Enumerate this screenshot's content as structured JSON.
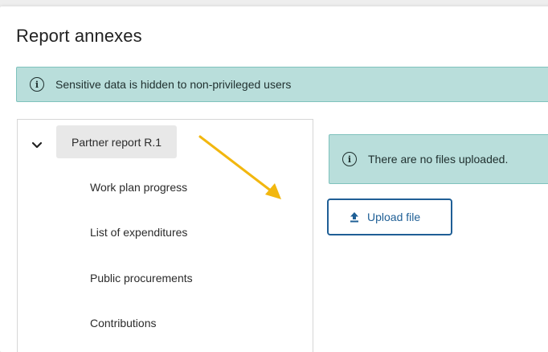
{
  "header": {
    "title": "Report annexes"
  },
  "alerts": {
    "sensitive": "Sensitive data is hidden to non-privileged users",
    "no_files": "There are no files uploaded."
  },
  "tree": {
    "root_label": "Partner report R.1",
    "children": [
      "Work plan progress",
      "List of expenditures",
      "Public procurements",
      "Contributions"
    ]
  },
  "actions": {
    "upload_label": "Upload file"
  },
  "colors": {
    "alert_bg": "#b9dedb",
    "primary": "#1f5f96",
    "annotation_arrow": "#f2b70f"
  },
  "icons": {
    "info": "info-circle-icon",
    "chevron": "chevron-down-icon",
    "upload": "upload-arrow-icon"
  }
}
